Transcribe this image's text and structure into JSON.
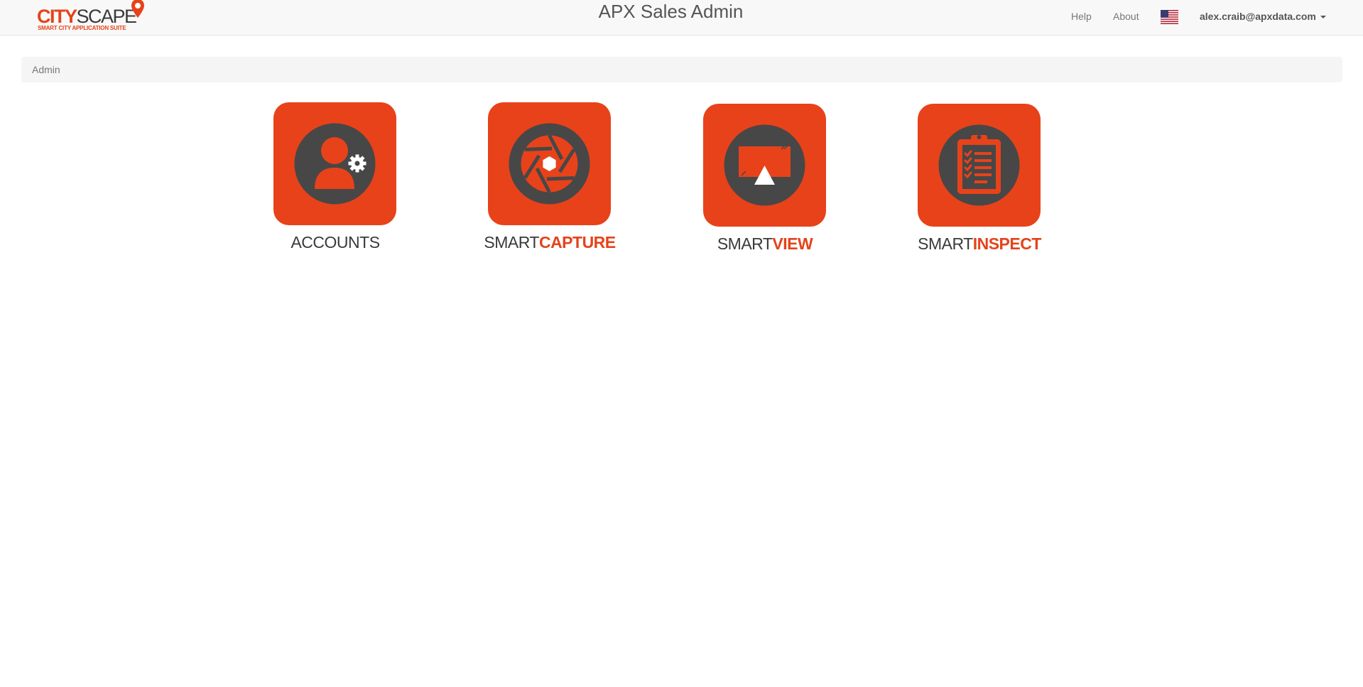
{
  "header": {
    "logo": {
      "word_part1": "CITY",
      "word_part2": "SCAPE",
      "tagline": "SMART CITY APPLICATION SUITE"
    },
    "title": "APX Sales Admin",
    "nav": {
      "help": "Help",
      "about": "About",
      "language_flag": "us-flag-icon",
      "user_email": "alex.craib@apxdata.com"
    }
  },
  "breadcrumb": {
    "items": [
      "Admin"
    ]
  },
  "tiles": [
    {
      "icon": "user-gear-icon",
      "label_part1": "ACCOUNTS",
      "label_part2": ""
    },
    {
      "icon": "camera-aperture-icon",
      "label_part1": "SMART",
      "label_part2": "CAPTURE"
    },
    {
      "icon": "display-screen-icon",
      "label_part1": "SMART",
      "label_part2": "VIEW"
    },
    {
      "icon": "clipboard-checklist-icon",
      "label_part1": "SMART",
      "label_part2": "INSPECT"
    }
  ],
  "colors": {
    "brand_orange": "#e8421a",
    "icon_dark": "#474747",
    "navbar_bg": "#f8f8f8",
    "breadcrumb_bg": "#f5f5f5"
  }
}
